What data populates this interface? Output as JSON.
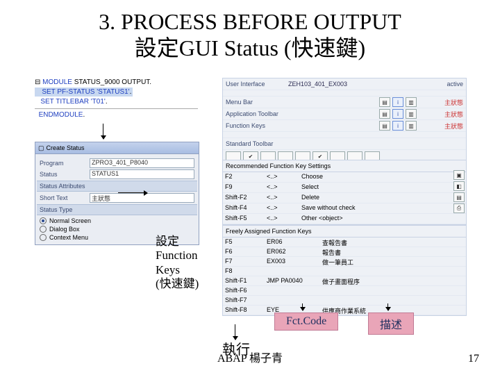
{
  "title_line1": "3. PROCESS BEFORE OUTPUT",
  "title_line2": "設定GUI Status (快速鍵)",
  "code": {
    "l1_a": "MODULE ",
    "l1_b": "STATUS_9000 OUTPUT",
    "l2_a": "SET PF-STATUS ",
    "l2_b": "'STATUS1'",
    "l3_a": "SET TITLEBAR ",
    "l3_b": "'T01'",
    "l4": "ENDMODULE"
  },
  "dialog": {
    "title": "Create Status",
    "program_lbl": "Program",
    "program_val": "ZPRO3_401_P8040",
    "status_lbl": "Status",
    "status_val": "STATUS1",
    "attr_head": "Status Attributes",
    "shorttext_lbl": "Short Text",
    "shorttext_val": "主狀態",
    "type_head": "Status Type",
    "r1": "Normal Screen",
    "r2": "Dialog Box",
    "r3": "Context Menu"
  },
  "sap_top": {
    "ui_lbl": "User Interface",
    "ui_val": "ZEH103_401_EX003",
    "ui_status": "active",
    "menu_lbl": "Menu Bar",
    "menu_note": "主狀態",
    "toolbar_lbl": "Application Toolbar",
    "toolbar_note": "主狀態",
    "fkeys_lbl": "Function Keys",
    "fkeys_note": "主狀態",
    "std_lbl": "Standard Toolbar"
  },
  "sap_mid": {
    "head": "Recommended Function Key Settings",
    "rows": [
      {
        "k": "F2",
        "v": "<..>",
        "d": "Choose"
      },
      {
        "k": "F9",
        "v": "<..>",
        "d": "Select"
      },
      {
        "k": "Shift-F2",
        "v": "<..>",
        "d": "Delete"
      },
      {
        "k": "Shift-F4",
        "v": "<..>",
        "d": "Save without check"
      },
      {
        "k": "Shift-F5",
        "v": "<..>",
        "d": "Other <object>"
      }
    ]
  },
  "sap_bot": {
    "head": "Freely Assigned Function Keys",
    "rows": [
      {
        "k": "F5",
        "v": "ER06",
        "d": "查報告書"
      },
      {
        "k": "F6",
        "v": "ER062",
        "d": "報告書"
      },
      {
        "k": "F7",
        "v": "EX003",
        "d": "做一筆員工"
      },
      {
        "k": "F8",
        "v": "",
        "d": ""
      },
      {
        "k": "Shift-F1",
        "v": "JMP PA0040",
        "d": "做子畫面程序"
      },
      {
        "k": "Shift-F6",
        "v": "",
        "d": ""
      },
      {
        "k": "Shift-F7",
        "v": "",
        "d": ""
      },
      {
        "k": "Shift-F8",
        "v": "EYE",
        "d": "供應商作業系統"
      }
    ]
  },
  "anno": {
    "fkeys1": "設定",
    "fkeys2": "Function",
    "fkeys3": "Keys",
    "fkeys4": "(快速鍵)",
    "btn_fct": "Fct.Code",
    "btn_desc": "描述",
    "exec": "執行"
  },
  "footer": "ABAP 楊子青",
  "pagenum": "17"
}
